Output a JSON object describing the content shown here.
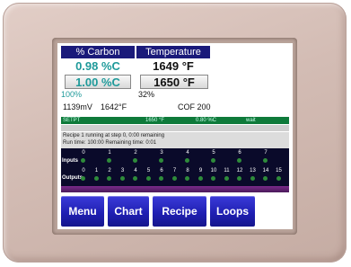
{
  "header": {
    "left_title": "% Carbon",
    "right_title": "Temperature"
  },
  "process": {
    "carbon_value": "0.98 %C",
    "temp_value": "1649 °F",
    "carbon_setpoint": "1.00 %C",
    "temp_setpoint": "1650 °F",
    "carbon_output": "100%",
    "temp_output": "32%"
  },
  "info": {
    "millivolts": "1139mV",
    "probe_temp": "1642°F",
    "cof": "COF 200"
  },
  "setpoint_bar": {
    "label": "SETPT",
    "temp": "1650 °F",
    "carbon": "0.80 %C",
    "state": "wait"
  },
  "recipe_status": {
    "line1": "Recipe 1 running at step 0, 0:00 remaining",
    "line2": "Run time: 100:00   Remaining time: 0:01"
  },
  "io": {
    "inputs_label": "Inputs",
    "outputs_label": "Outputs",
    "input_numbers": [
      "0",
      "1",
      "2",
      "3",
      "4",
      "5",
      "6",
      "7"
    ],
    "output_numbers": [
      "0",
      "1",
      "2",
      "3",
      "4",
      "5",
      "6",
      "7",
      "8",
      "9",
      "10",
      "11",
      "12",
      "13",
      "14",
      "15"
    ]
  },
  "buttons": {
    "menu": "Menu",
    "chart": "Chart",
    "recipe": "Recipe",
    "loops": "Loops"
  },
  "colors": {
    "header_bg": "#1a1a7a",
    "carbon_text": "#1f9a9a",
    "button_bg": "#2323c0",
    "status_green": "#0e7a3a"
  }
}
